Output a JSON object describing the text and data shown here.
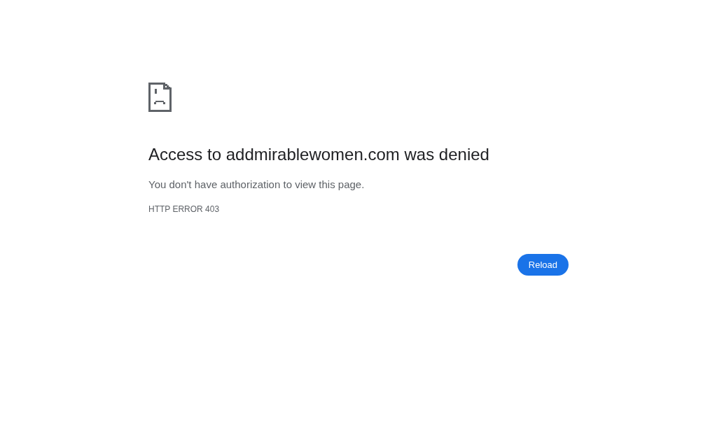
{
  "error_page": {
    "title": "Access to addmirablewomen.com was denied",
    "message": "You don't have authorization to view this page.",
    "error_code": "HTTP ERROR 403"
  },
  "buttons": [
    {
      "label": "Reload"
    }
  ]
}
